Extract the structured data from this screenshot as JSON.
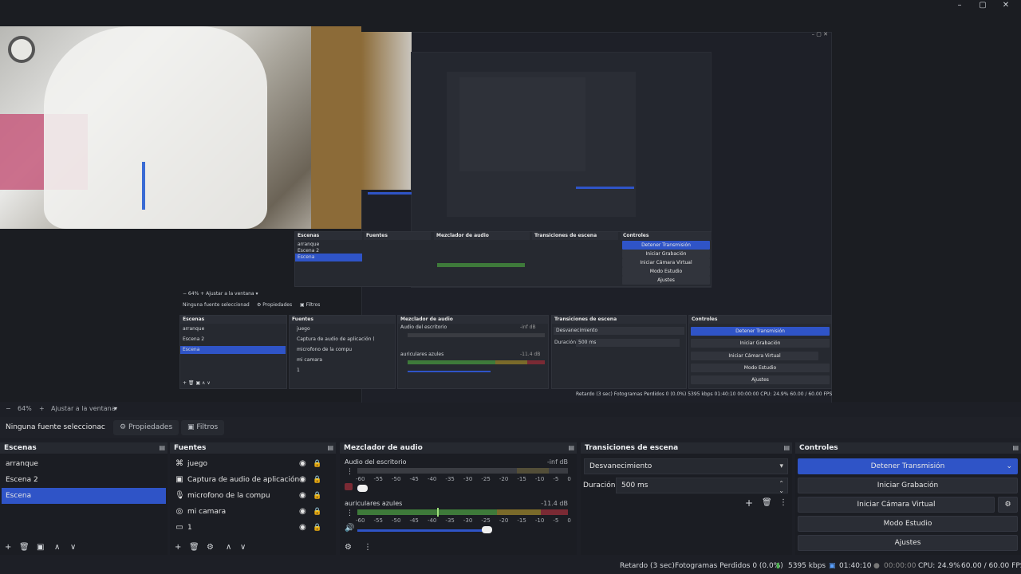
{
  "preview_status": {
    "zoom": "64%",
    "fit_label": "Ajustar a la ventana"
  },
  "nested_preview": {
    "no_source": "Ninguna fuente seleccionad",
    "props": "Propiedades",
    "filters": "Filtros",
    "scenes_title": "Escenas",
    "sources_title": "Fuentes",
    "mixer_title": "Mezclador de audio",
    "transitions_title": "Transiciones de escena",
    "controls_title": "Controles",
    "scenes": [
      "arranque",
      "Escena 2",
      "Escena"
    ],
    "sources": [
      "juego",
      "Captura de audio de aplicación (BET",
      "microfono de la compu",
      "mi camara",
      "1"
    ],
    "mix1": "Audio del escritorio",
    "mix1_db": "-inf dB",
    "mix2": "auriculares azules",
    "mix2_db": "-11.4 dB",
    "transition": "Desvanecimiento",
    "duration_label": "Duración",
    "duration": "500 ms",
    "btns": [
      "Detener Transmisión",
      "Iniciar Grabación",
      "Iniciar Cámara Virtual",
      "Modo Estudio",
      "Ajustes"
    ],
    "status": "Retardo (3 sec)   Fotogramas Perdidos 0 (0.0%)   5395 kbps   01:40:10   00:00:00   CPU: 24.9%   60.00 / 60.00 FPS"
  },
  "propbar": {
    "no_source": "Ninguna fuente seleccionac",
    "properties": "Propiedades",
    "filters": "Filtros"
  },
  "scenes": {
    "title": "Escenas",
    "items": [
      "arranque",
      "Escena 2",
      "Escena"
    ],
    "selected": "Escena"
  },
  "sources": {
    "title": "Fuentes",
    "items": [
      {
        "label": "juego",
        "icon": "gamepad-icon"
      },
      {
        "label": "Captura de audio de aplicación (BET",
        "icon": "app-audio-icon"
      },
      {
        "label": "microfono de la compu",
        "icon": "microphone-icon"
      },
      {
        "label": "mi camara",
        "icon": "camera-icon"
      },
      {
        "label": "1",
        "icon": "display-icon"
      }
    ]
  },
  "mixer": {
    "title": "Mezclador de audio",
    "channels": [
      {
        "name": "Audio del escritorio",
        "db": "-inf dB",
        "muted": true,
        "level": 0.0
      },
      {
        "name": "auriculares azules",
        "db": "-11.4 dB",
        "muted": false,
        "level": 0.72
      }
    ],
    "ticks": [
      "-60",
      "-55",
      "-50",
      "-45",
      "-40",
      "-35",
      "-30",
      "-25",
      "-20",
      "-15",
      "-10",
      "-5",
      "0"
    ]
  },
  "transitions": {
    "title": "Transiciones de escena",
    "selected": "Desvanecimiento",
    "duration_label": "Duración",
    "duration": "500 ms"
  },
  "controls": {
    "title": "Controles",
    "stop_stream": "Detener Transmisión",
    "start_recording": "Iniciar Grabación",
    "start_virtualcam": "Iniciar Cámara Virtual",
    "studio_mode": "Modo Estudio",
    "settings": "Ajustes"
  },
  "statusbar": {
    "delay": "Retardo (3 sec)",
    "dropped": "Fotogramas Perdidos 0 (0.0%)",
    "bitrate": "5395 kbps",
    "stream_time": "01:40:10",
    "rec_time": "00:00:00",
    "cpu": "CPU: 24.9%",
    "fps": "60.00 / 60.00 FPS"
  },
  "colors": {
    "accent": "#2f54c7",
    "bg": "#1d1f26",
    "panel": "#262930"
  }
}
